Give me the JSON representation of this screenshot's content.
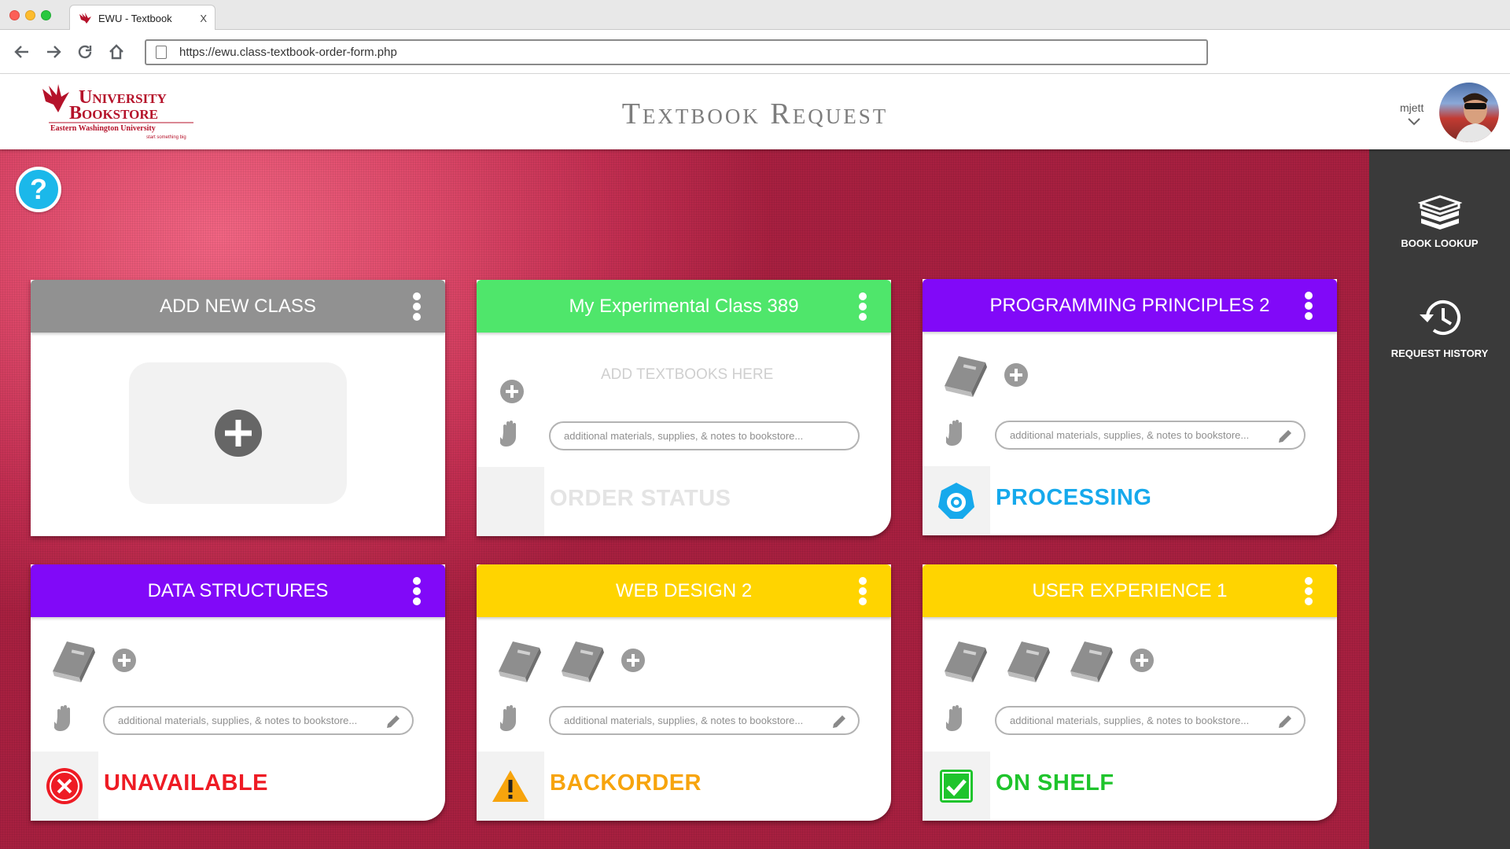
{
  "browser": {
    "tab_title": "EWU - Textbook",
    "tab_close": "X",
    "url": "https://ewu.class-textbook-order-form.php"
  },
  "header": {
    "logo": {
      "line1": "University",
      "line2": "Bookstore",
      "line3": "Eastern Washington University",
      "tagline": "start something big"
    },
    "title": "Textbook Request",
    "username": "mjett"
  },
  "sidebar": {
    "items": [
      {
        "label": "BOOK LOOKUP",
        "icon": "books-stack-icon"
      },
      {
        "label": "REQUEST HISTORY",
        "icon": "history-icon"
      }
    ]
  },
  "help": {
    "label": "?"
  },
  "colors": {
    "gray": "#919191",
    "green": "#4fe66b",
    "purple": "#8109f8",
    "yellow": "#ffd400",
    "status_processing": "#16a9ec",
    "status_unavailable": "#ee1b24",
    "status_backorder": "#f7a40d",
    "status_onshelf": "#1fc42c",
    "status_placeholder": "#e4e4e4"
  },
  "notes_placeholder": "additional materials, supplies, & notes to bookstore...",
  "cards": [
    {
      "title": "ADD NEW CLASS",
      "type": "add"
    },
    {
      "title": "My Experimental Class 389",
      "books": 0,
      "add_text": "ADD TEXTBOOKS HERE",
      "status": "ORDER STATUS"
    },
    {
      "title": "PROGRAMMING PRINCIPLES 2",
      "books": 1,
      "status": "PROCESSING"
    },
    {
      "title": "DATA STRUCTURES",
      "books": 1,
      "status": "UNAVAILABLE"
    },
    {
      "title": "WEB DESIGN 2",
      "books": 2,
      "status": "BACKORDER"
    },
    {
      "title": "USER EXPERIENCE 1",
      "books": 3,
      "status": "ON SHELF"
    }
  ]
}
